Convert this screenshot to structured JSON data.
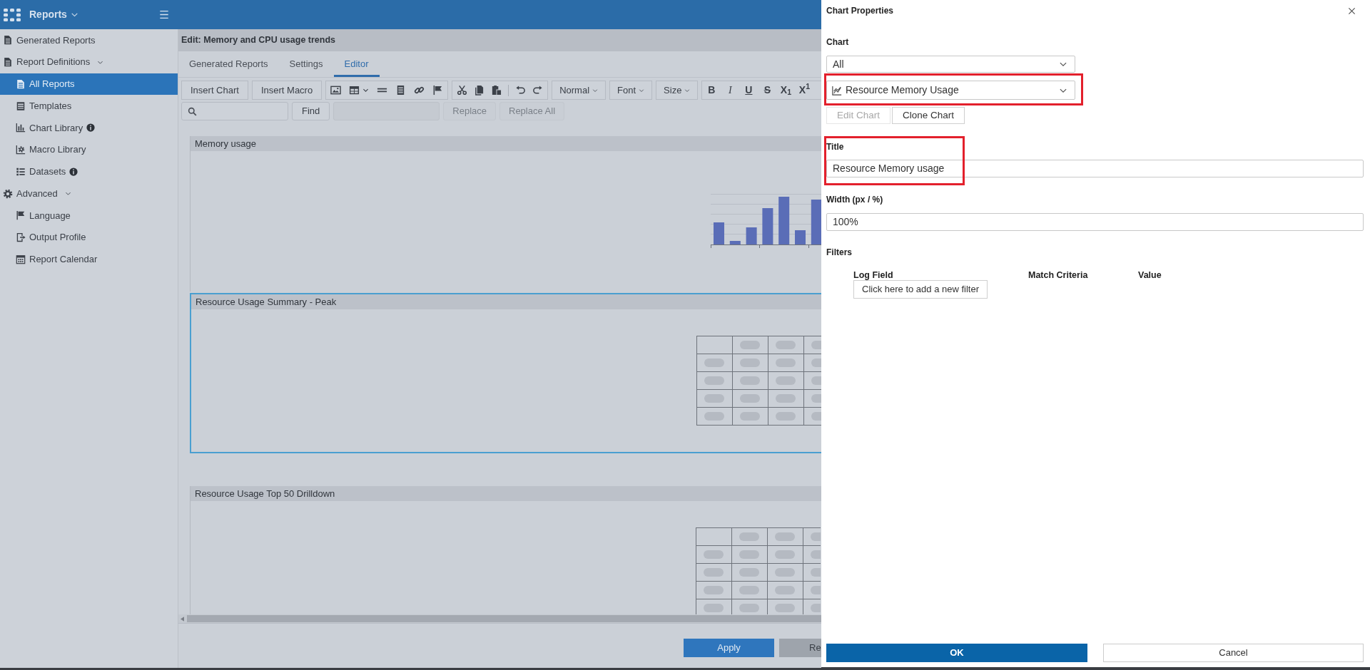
{
  "top_bar": {
    "app_menu": "Reports"
  },
  "sidebar": {
    "items": [
      {
        "label": "Generated Reports",
        "selected": false
      },
      {
        "label": "Report Definitions",
        "selected": false,
        "expanded": true,
        "children": [
          {
            "label": "All Reports",
            "selected": true
          },
          {
            "label": "Templates",
            "selected": false
          },
          {
            "label": "Chart Library",
            "selected": false,
            "info": true
          },
          {
            "label": "Macro Library",
            "selected": false
          },
          {
            "label": "Datasets",
            "selected": false,
            "info": true
          }
        ]
      },
      {
        "label": "Advanced",
        "selected": false,
        "expanded": true,
        "children": [
          {
            "label": "Language",
            "selected": false
          },
          {
            "label": "Output Profile",
            "selected": false
          },
          {
            "label": "Report Calendar",
            "selected": false
          }
        ]
      }
    ]
  },
  "editor": {
    "title": "Edit: Memory and CPU usage trends",
    "tabs": [
      {
        "label": "Generated Reports",
        "selected": false
      },
      {
        "label": "Settings",
        "selected": false
      },
      {
        "label": "Editor",
        "selected": true
      }
    ],
    "toolbar": {
      "insert_buttons": [
        "Insert Chart",
        "Insert Macro"
      ],
      "dropdowns": [
        "Normal",
        "Font",
        "Size"
      ],
      "format_buttons": [
        {
          "kind": "bold",
          "label": "B"
        },
        {
          "kind": "italic",
          "label": "I"
        },
        {
          "kind": "underline",
          "label": "U"
        },
        {
          "kind": "strikethrough",
          "label": "S"
        },
        {
          "kind": "subscript",
          "label": "X$_{1}$"
        },
        {
          "kind": "superscript",
          "label": "X$^{1}$"
        }
      ],
      "find_button": "Find",
      "replace_buttons": [
        {
          "label": "Replace",
          "disabled": true
        },
        {
          "label": "Replace All",
          "disabled": true
        }
      ]
    },
    "blocks": [
      {
        "title": "Memory usage",
        "kind": "chart",
        "selected": false
      },
      {
        "title": "Resource Usage Summary - Peak",
        "kind": "table",
        "selected": true
      },
      {
        "title": "Resource Usage Top 50 Drilldown",
        "kind": "table",
        "selected": false
      }
    ],
    "footer_buttons": [
      {
        "label": "Apply",
        "kind": "primary"
      },
      {
        "label": "Re",
        "kind": "secondary"
      }
    ]
  },
  "chart_properties": {
    "title": "Chart Properties",
    "chart_label": "Chart",
    "category_select": {
      "value": "All"
    },
    "chart_select": {
      "value": "Resource Memory Usage",
      "highlighted": true
    },
    "buttons": [
      {
        "label": "Edit Chart",
        "disabled": true
      },
      {
        "label": "Clone Chart",
        "disabled": false
      }
    ],
    "title_field": {
      "label": "Title",
      "value": "Resource Memory usage",
      "highlighted": true
    },
    "width_field": {
      "label": "Width (px / %)",
      "value": "100%"
    },
    "filters": {
      "label": "Filters",
      "columns": [
        "Log Field",
        "Match Criteria",
        "Value"
      ],
      "add_button": "Click here to add a new filter"
    },
    "footer_buttons": [
      {
        "label": "OK",
        "kind": "primary"
      },
      {
        "label": "Cancel",
        "kind": "secondary"
      }
    ]
  }
}
